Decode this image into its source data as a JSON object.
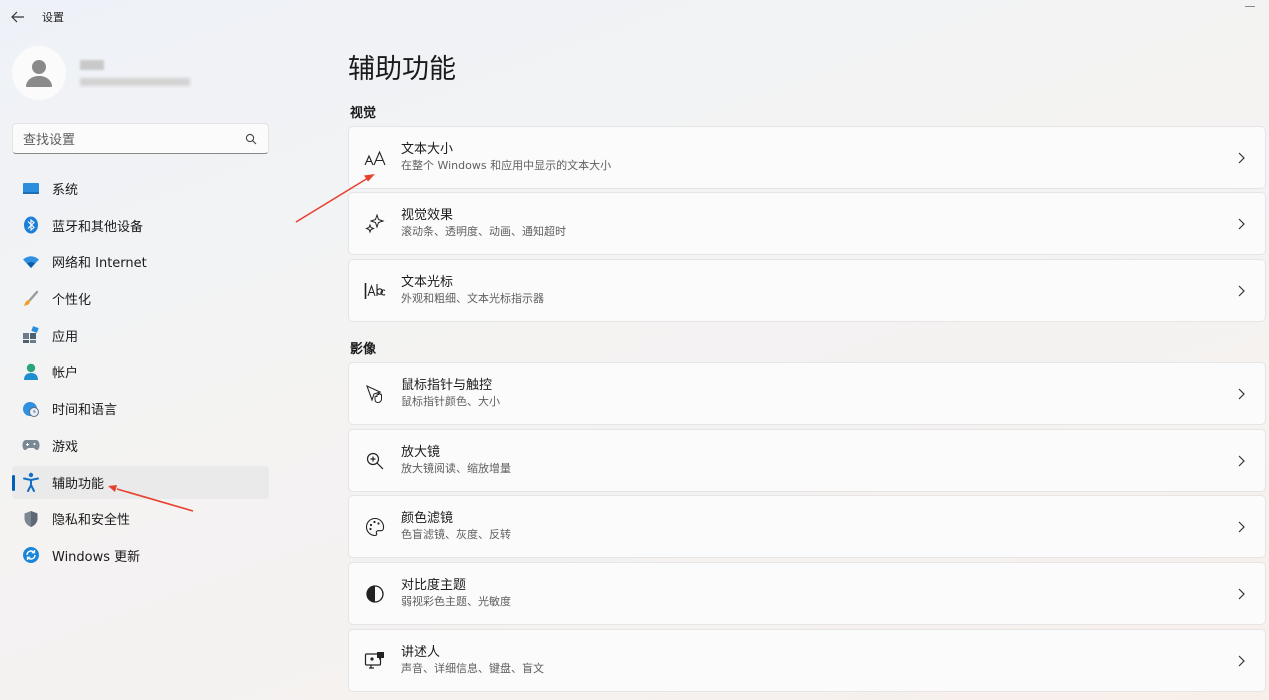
{
  "window": {
    "title": "设置",
    "back_icon": "arrow-left-icon"
  },
  "search": {
    "placeholder": "查找设置",
    "icon": "search-icon"
  },
  "sidebar": {
    "items": [
      {
        "label": "系统",
        "icon": "monitor-icon",
        "active": false
      },
      {
        "label": "蓝牙和其他设备",
        "icon": "bluetooth-icon",
        "active": false
      },
      {
        "label": "网络和 Internet",
        "icon": "wifi-icon",
        "active": false
      },
      {
        "label": "个性化",
        "icon": "paintbrush-icon",
        "active": false
      },
      {
        "label": "应用",
        "icon": "apps-icon",
        "active": false
      },
      {
        "label": "帐户",
        "icon": "person-icon",
        "active": false
      },
      {
        "label": "时间和语言",
        "icon": "globe-clock-icon",
        "active": false
      },
      {
        "label": "游戏",
        "icon": "gamepad-icon",
        "active": false
      },
      {
        "label": "辅助功能",
        "icon": "accessibility-icon",
        "active": true
      },
      {
        "label": "隐私和安全性",
        "icon": "shield-icon",
        "active": false
      },
      {
        "label": "Windows 更新",
        "icon": "update-icon",
        "active": false
      }
    ]
  },
  "main": {
    "title": "辅助功能",
    "sections": [
      {
        "label": "视觉",
        "cards": [
          {
            "title": "文本大小",
            "desc": "在整个 Windows 和应用中显示的文本大小",
            "icon": "text-size-icon"
          },
          {
            "title": "视觉效果",
            "desc": "滚动条、透明度、动画、通知超时",
            "icon": "sparkle-icon"
          },
          {
            "title": "文本光标",
            "desc": "外观和粗细、文本光标指示器",
            "icon": "text-cursor-icon"
          }
        ]
      },
      {
        "label": "影像",
        "cards": [
          {
            "title": "鼠标指针与触控",
            "desc": "鼠标指针颜色、大小",
            "icon": "mouse-pointer-icon"
          },
          {
            "title": "放大镜",
            "desc": "放大镜阅读、缩放增量",
            "icon": "magnifier-icon"
          },
          {
            "title": "颜色滤镜",
            "desc": "色盲滤镜、灰度、反转",
            "icon": "palette-icon"
          },
          {
            "title": "对比度主题",
            "desc": "弱视彩色主题、光敏度",
            "icon": "contrast-icon"
          },
          {
            "title": "讲述人",
            "desc": "声音、详细信息、键盘、盲文",
            "icon": "narrator-icon"
          }
        ]
      }
    ]
  },
  "colors": {
    "accent": "#005fb8",
    "annotation": "#e8402f"
  }
}
